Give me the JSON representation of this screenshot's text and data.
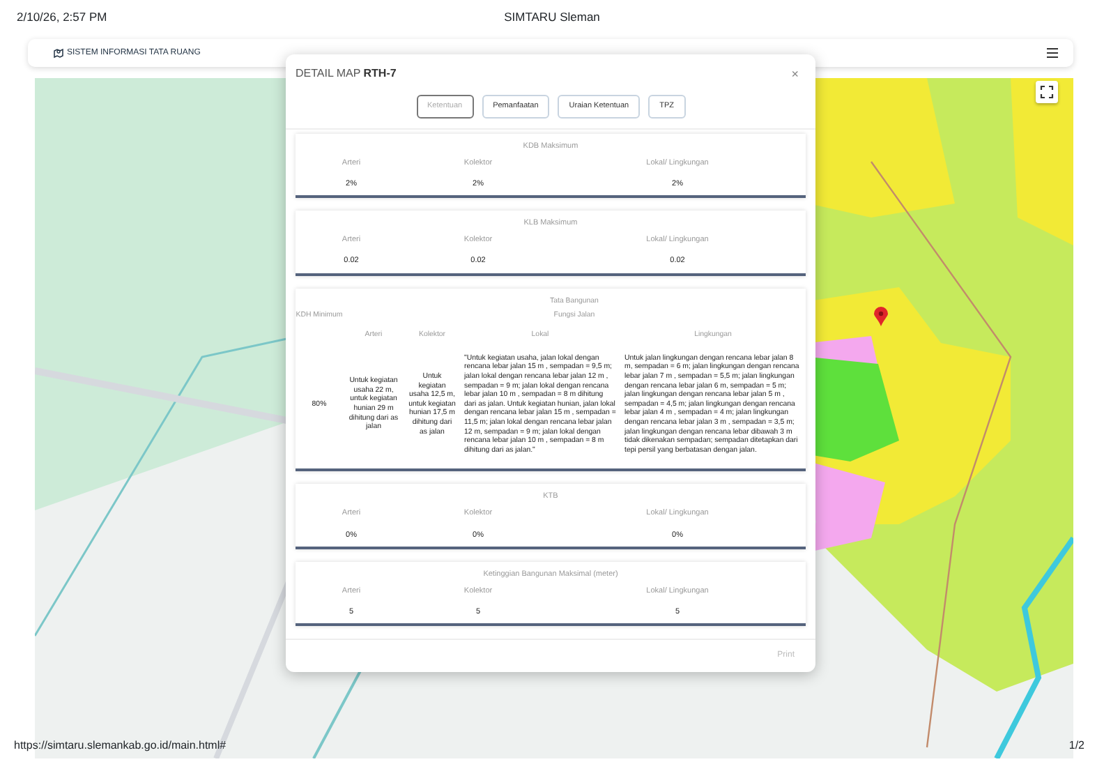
{
  "print_header": {
    "date": "2/10/26, 2:57 PM",
    "title": "SIMTARU Sleman"
  },
  "navbar": {
    "brand": "SISTEM INFORMASI TATA RUANG"
  },
  "modal": {
    "title": "DETAIL MAP",
    "code": "RTH-7",
    "close": "×",
    "tabs": [
      {
        "label": "Ketentuan",
        "selected": true
      },
      {
        "label": "Pemanfaatan",
        "selected": false
      },
      {
        "label": "Uraian Ketentuan",
        "selected": false
      },
      {
        "label": "TPZ",
        "selected": false
      }
    ],
    "sections": [
      {
        "kind": "simple",
        "title": "KDB Maksimum",
        "columns": [
          "Arteri",
          "Kolektor",
          "Lokal/ Lingkungan"
        ],
        "values": [
          "2%",
          "2%",
          "2%"
        ]
      },
      {
        "kind": "simple",
        "title": "KLB Maksimum",
        "columns": [
          "Arteri",
          "Kolektor",
          "Lokal/ Lingkungan"
        ],
        "values": [
          "0.02",
          "0.02",
          "0.02"
        ]
      },
      {
        "kind": "building",
        "title": "Tata Bangunan",
        "kdh_label": "KDH Minimum",
        "group_label": "Fungsi Jalan",
        "columns": [
          "Arteri",
          "Kolektor",
          "Lokal",
          "Lingkungan"
        ],
        "kdh_value": "80%",
        "values": [
          "Untuk kegiatan usaha 22 m, untuk kegiatan hunian 29 m dihitung dari as jalan",
          "Untuk kegiatan usaha 12,5 m, untuk kegiatan hunian 17,5 m dihitung dari as jalan",
          "\"Untuk kegiatan usaha, jalan lokal dengan rencana lebar jalan 15 m , sempadan = 9,5 m; jalan lokal dengan rencana lebar jalan 12 m , sempadan = 9 m; jalan lokal dengan rencana lebar jalan 10 m , sempadan = 8 m dihitung dari as jalan. Untuk kegiatan hunian, jalan lokal dengan rencana lebar jalan 15 m , sempadan = 11,5 m; jalan lokal dengan rencana lebar jalan 12 m, sempadan = 9 m; jalan lokal dengan rencana lebar jalan 10 m , sempadan = 8 m dihitung dari as jalan.\"",
          "Untuk jalan lingkungan dengan rencana lebar jalan 8 m, sempadan = 6 m; jalan lingkungan dengan rencana lebar jalan 7 m , sempadan = 5,5 m; jalan lingkungan dengan rencana lebar jalan 6 m, sempadan = 5 m; jalan lingkungan dengan rencana lebar jalan 5 m , sempadan = 4,5 m; jalan lingkungan dengan rencana lebar jalan 4 m , sempadan = 4 m; jalan lingkungan dengan rencana lebar jalan 3 m , sempadan = 3,5 m; jalan lingkungan dengan rencana lebar dibawah 3 m tidak dikenakan sempadan; sempadan ditetapkan dari tepi persil yang berbatasan dengan jalan."
        ]
      },
      {
        "kind": "simple",
        "title": "KTB",
        "columns": [
          "Arteri",
          "Kolektor",
          "Lokal/ Lingkungan"
        ],
        "values": [
          "0%",
          "0%",
          "0%"
        ]
      },
      {
        "kind": "simple",
        "title": "Ketinggian Bangunan Maksimal (meter)",
        "columns": [
          "Arteri",
          "Kolektor",
          "Lokal/ Lingkungan"
        ],
        "values": [
          "5",
          "5",
          "5"
        ]
      }
    ],
    "print_button": {
      "label": "Print",
      "disabled": true
    }
  },
  "footer": {
    "url": "https://simtaru.slemankab.go.id/main.html#",
    "page": "1/2"
  }
}
